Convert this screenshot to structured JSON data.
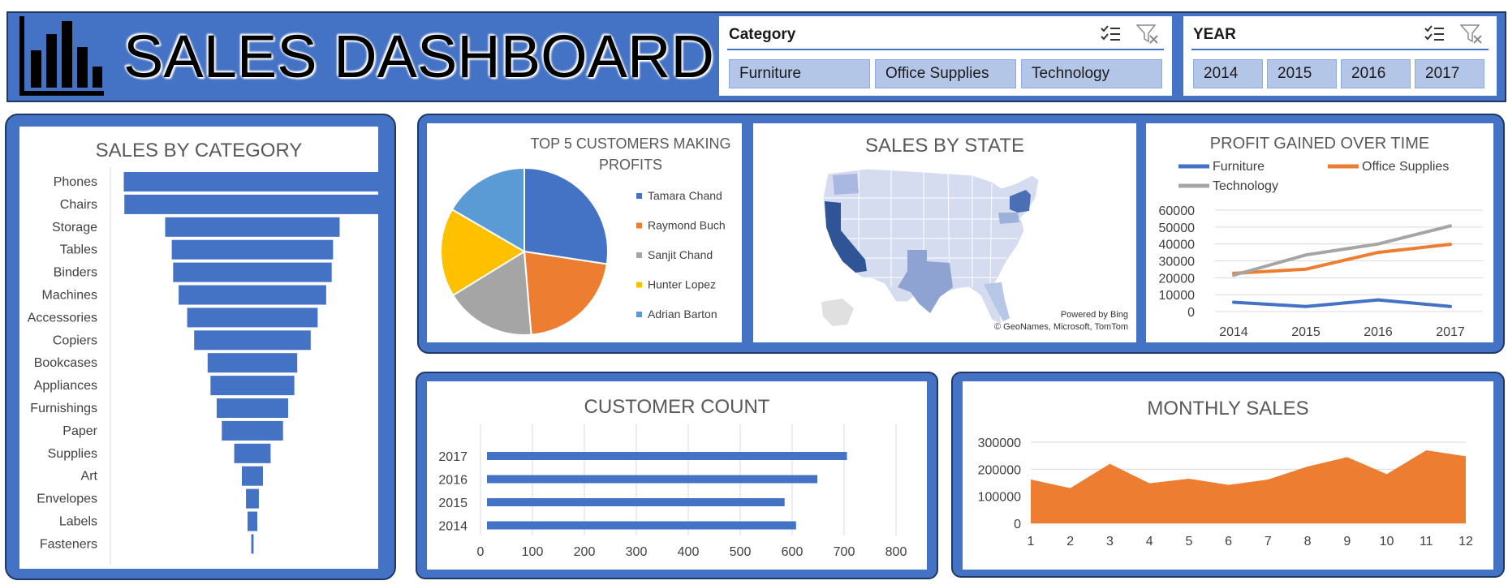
{
  "header": {
    "title": "SALES DASHBOARD",
    "logo_icon": "bar-chart-icon",
    "category_slicer": {
      "label": "Category",
      "items": [
        "Furniture",
        "Office Supplies",
        "Technology"
      ],
      "multi_select_icon": "multi-select-icon",
      "clear_filter_icon": "clear-filter-icon"
    },
    "year_slicer": {
      "label": "YEAR",
      "items": [
        "2014",
        "2015",
        "2016",
        "2017"
      ],
      "multi_select_icon": "multi-select-icon",
      "clear_filter_icon": "clear-filter-icon"
    }
  },
  "map": {
    "title": "SALES BY STATE",
    "attribution_line1": "Powered by Bing",
    "attribution_line2": "© GeoNames, Microsoft, TomTom"
  },
  "colors": {
    "accent": "#4472c4",
    "orange": "#ed7d31",
    "gray": "#a5a5a5",
    "yellow": "#ffc000",
    "lightblue": "#5b9bd5"
  },
  "chart_data": [
    {
      "id": "sales-by-category",
      "type": "bar",
      "title": "SALES BY CATEGORY",
      "style": "funnel",
      "categories": [
        "Phones",
        "Chairs",
        "Storage",
        "Tables",
        "Binders",
        "Machines",
        "Accessories",
        "Copiers",
        "Bookcases",
        "Appliances",
        "Furnishings",
        "Paper",
        "Supplies",
        "Art",
        "Envelopes",
        "Labels",
        "Fasteners"
      ],
      "values": [
        330000,
        328500,
        223800,
        206900,
        203400,
        189200,
        167400,
        149500,
        114900,
        107500,
        91700,
        78500,
        46700,
        27100,
        16500,
        12500,
        3000
      ]
    },
    {
      "id": "top-customers",
      "type": "pie",
      "title": "TOP 5 CUSTOMERS MAKING PROFITS",
      "categories": [
        "Tamara Chand",
        "Raymond Buch",
        "Sanjit Chand",
        "Hunter Lopez",
        "Adrian Barton"
      ],
      "values": [
        8981,
        6976,
        5757,
        5622,
        5444
      ],
      "colors": [
        "#4472c4",
        "#ed7d31",
        "#a5a5a5",
        "#ffc000",
        "#5b9bd5"
      ],
      "legend": "right"
    },
    {
      "id": "profit-over-time",
      "type": "line",
      "title": "PROFIT GAINED OVER TIME",
      "x": [
        "2014",
        "2015",
        "2016",
        "2017"
      ],
      "series": [
        {
          "name": "Furniture",
          "values": [
            5500,
            3000,
            6900,
            3000
          ],
          "color": "#4472c4"
        },
        {
          "name": "Office Supplies",
          "values": [
            22600,
            25100,
            35000,
            39800
          ],
          "color": "#ed7d31"
        },
        {
          "name": "Technology",
          "values": [
            21500,
            33500,
            40000,
            50700
          ],
          "color": "#a5a5a5"
        }
      ],
      "yticks": [
        "0",
        "10000",
        "20000",
        "30000",
        "40000",
        "50000",
        "60000"
      ],
      "ylim": [
        0,
        60000
      ],
      "grid": true,
      "legend": "top"
    },
    {
      "id": "customer-count",
      "type": "bar",
      "title": "CUSTOMER COUNT",
      "orientation": "horizontal",
      "categories": [
        "2017",
        "2016",
        "2015",
        "2014"
      ],
      "values": [
        693,
        636,
        573,
        595
      ],
      "xticks": [
        "0",
        "100",
        "200",
        "300",
        "400",
        "500",
        "600",
        "700",
        "800"
      ],
      "xlim": [
        0,
        800
      ],
      "grid": true
    },
    {
      "id": "monthly-sales",
      "type": "area",
      "title": "MONTHLY SALES",
      "x": [
        "1",
        "2",
        "3",
        "4",
        "5",
        "6",
        "7",
        "8",
        "9",
        "10",
        "11",
        "12"
      ],
      "values": [
        162000,
        130000,
        220000,
        148000,
        165000,
        142000,
        162000,
        210000,
        245000,
        182000,
        270000,
        248000
      ],
      "yticks": [
        "0",
        "100000",
        "200000",
        "300000"
      ],
      "ylim": [
        0,
        300000
      ],
      "grid": true,
      "color": "#ed7d31"
    }
  ]
}
